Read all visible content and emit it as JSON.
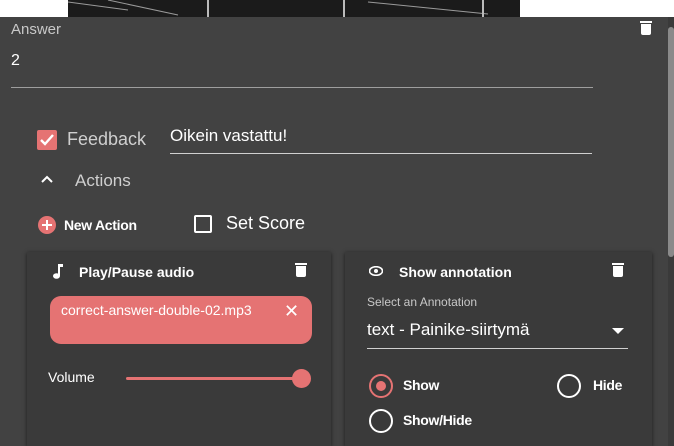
{
  "answer": {
    "label": "Answer",
    "value": "2"
  },
  "feedback": {
    "checked": true,
    "label": "Feedback",
    "value": "Oikein vastattu!"
  },
  "actions": {
    "label": "Actions",
    "new_action_label": "New Action",
    "set_score_label": "Set Score"
  },
  "audio_card": {
    "title": "Play/Pause audio",
    "file_chip": "correct-answer-double-02.mp3",
    "volume_label": "Volume",
    "volume_level": 1.0
  },
  "annotation_card": {
    "title": "Show annotation",
    "select_label": "Select an Annotation",
    "select_value": "text - Painike-siirtymä",
    "options": [
      {
        "label": "Show",
        "selected": true
      },
      {
        "label": "Hide",
        "selected": false
      },
      {
        "label": "Show/Hide",
        "selected": false
      }
    ]
  },
  "colors": {
    "accent": "#e57373",
    "panel": "#424242",
    "card": "#3a3a3a"
  }
}
